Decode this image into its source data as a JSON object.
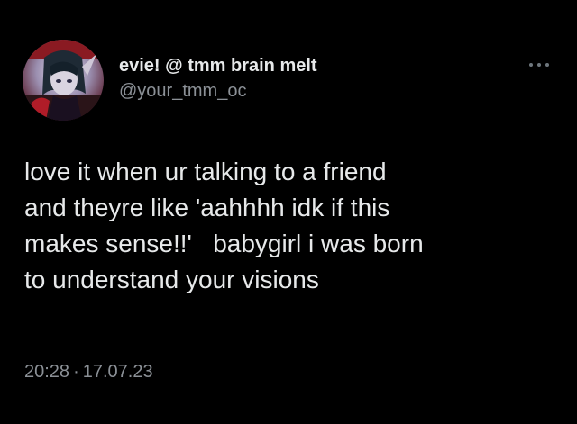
{
  "user": {
    "display_name": "evie! @ tmm brain melt",
    "handle": "@your_tmm_oc",
    "avatar_icon": "anime-character-avatar"
  },
  "more_icon": "more-dots-icon",
  "tweet": {
    "lines": [
      "love it when ur talking to a friend",
      "and theyre like 'aahhhh idk if this",
      "makes sense!!'   babygirl i was born",
      "to understand your visions"
    ]
  },
  "meta": {
    "time": "20:28",
    "separator": "·",
    "date": "17.07.23"
  },
  "colors": {
    "background": "#000000",
    "primary_text": "#e7e9ea",
    "secondary_text": "#8b9096"
  }
}
